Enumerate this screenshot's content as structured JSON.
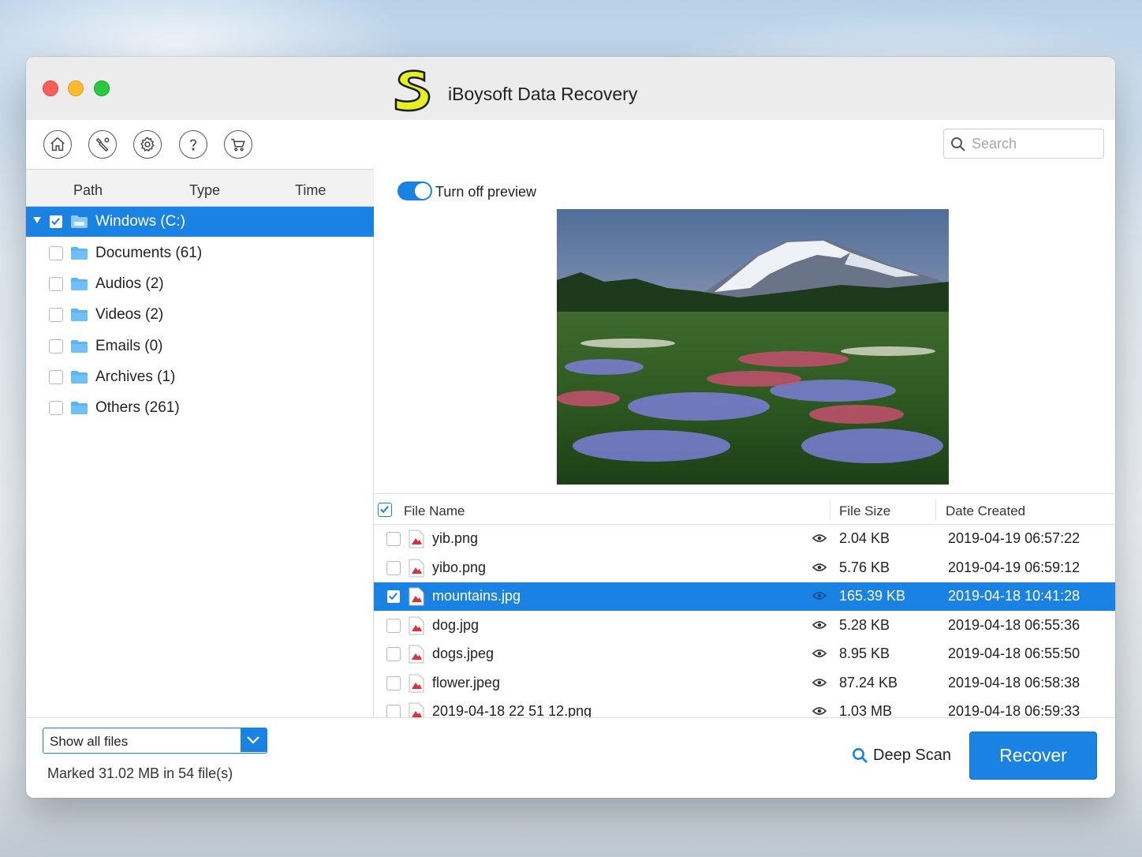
{
  "window": {
    "title": "iBoysoft Data Recovery",
    "accent_color": "#1a82e2"
  },
  "toolbar": {
    "buttons": [
      {
        "icon": "home-icon"
      },
      {
        "icon": "tools-icon"
      },
      {
        "icon": "gear-icon"
      },
      {
        "icon": "help-icon"
      },
      {
        "icon": "cart-icon"
      }
    ],
    "search_placeholder": "Search"
  },
  "left_pane": {
    "columns": [
      "Path",
      "Type",
      "Time"
    ],
    "tree": [
      {
        "label": "Windows (C:)",
        "checked": true,
        "selected": true,
        "icon": "drive-icon"
      },
      {
        "label": "Documents (61)",
        "checked": false,
        "icon": "folder-icon"
      },
      {
        "label": "Audios (2)",
        "checked": false,
        "icon": "folder-icon"
      },
      {
        "label": "Videos (2)",
        "checked": false,
        "icon": "folder-icon"
      },
      {
        "label": "Emails (0)",
        "checked": false,
        "icon": "folder-icon"
      },
      {
        "label": "Archives (1)",
        "checked": false,
        "icon": "folder-icon"
      },
      {
        "label": "Others (261)",
        "checked": false,
        "icon": "folder-icon"
      }
    ]
  },
  "preview": {
    "toggle_label": "Turn off preview",
    "toggle_on": true
  },
  "file_list": {
    "columns": {
      "name": "File Name",
      "size": "File Size",
      "date": "Date Created"
    },
    "rows": [
      {
        "name": "yib.png",
        "size": "2.04 KB",
        "date": "2019-04-19 06:57:22",
        "checked": false,
        "selected": false
      },
      {
        "name": "yibo.png",
        "size": "5.76 KB",
        "date": "2019-04-19 06:59:12",
        "checked": false,
        "selected": false
      },
      {
        "name": "mountains.jpg",
        "size": "165.39 KB",
        "date": "2019-04-18 10:41:28",
        "checked": true,
        "selected": true
      },
      {
        "name": "dog.jpg",
        "size": "5.28 KB",
        "date": "2019-04-18 06:55:36",
        "checked": false,
        "selected": false
      },
      {
        "name": "dogs.jpeg",
        "size": "8.95 KB",
        "date": "2019-04-18 06:55:50",
        "checked": false,
        "selected": false
      },
      {
        "name": "flower.jpeg",
        "size": "87.24 KB",
        "date": "2019-04-18 06:58:38",
        "checked": false,
        "selected": false
      },
      {
        "name": "2019-04-18 22 51 12.png",
        "size": "1.03 MB",
        "date": "2019-04-18 06:59:33",
        "checked": false,
        "selected": false
      }
    ]
  },
  "bottom": {
    "filter_value": "Show all files",
    "marked_text": "Marked 31.02 MB in 54 file(s)",
    "deep_scan_label": "Deep Scan",
    "recover_label": "Recover"
  }
}
